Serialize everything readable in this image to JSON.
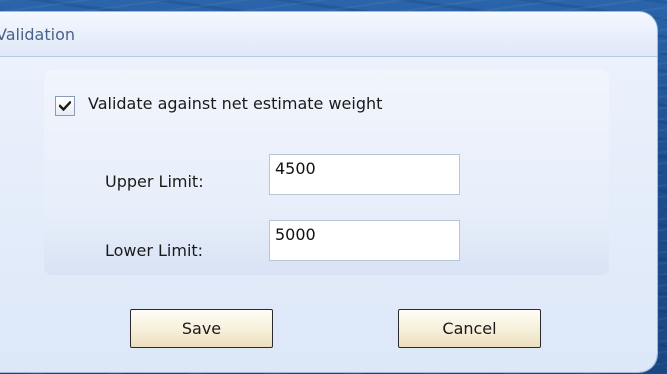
{
  "dialog": {
    "title": "Validation"
  },
  "validation": {
    "checkbox_label": "Validate against net estimate weight",
    "checkbox_checked": true,
    "upper_limit_label": "Upper Limit:",
    "upper_limit_value": "4500",
    "lower_limit_label": "Lower Limit:",
    "lower_limit_value": "5000"
  },
  "buttons": {
    "save_label": "Save",
    "cancel_label": "Cancel"
  },
  "icons": {
    "checkbox": "checkmark-icon"
  },
  "colors": {
    "background_blue": "#1f4f90",
    "dialog_fill": "#e3ecfa",
    "title_text": "#4a6287",
    "button_fill": "#f6efd9"
  }
}
